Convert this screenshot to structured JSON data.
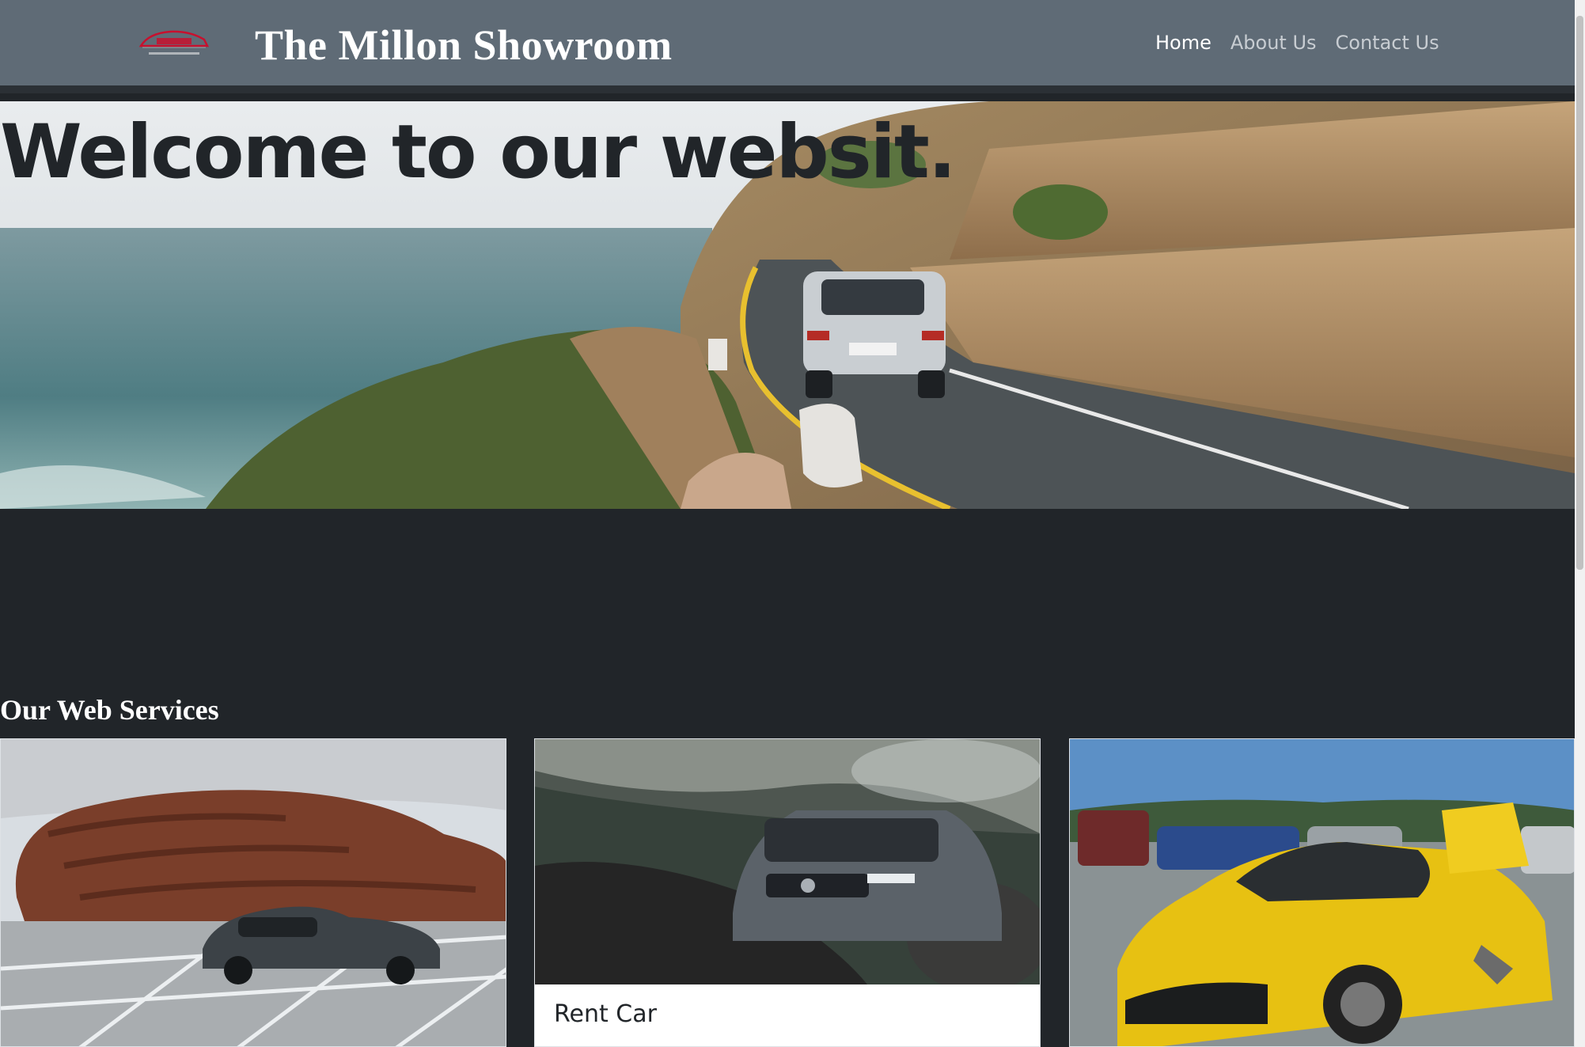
{
  "navbar": {
    "brand": "The Millon Showroom",
    "logo_icon": "red-car-logo-icon",
    "links": [
      {
        "label": "Home",
        "active": true
      },
      {
        "label": "About Us",
        "active": false
      },
      {
        "label": "Contact Us",
        "active": false
      }
    ]
  },
  "hero": {
    "title": "Welcome to our websit.",
    "image": "coastal-road-suv-photo"
  },
  "services": {
    "heading": "Our Web Services",
    "cards": [
      {
        "title": "",
        "image": "grey-sports-car-photo"
      },
      {
        "title": "Rent Car",
        "image": "grey-volvo-suv-photo"
      },
      {
        "title": "",
        "image": "yellow-damaged-charger-photo"
      }
    ]
  },
  "colors": {
    "navbar_bg": "#5f6b76",
    "page_bg": "#212529",
    "text_dark": "#212529",
    "text_light": "#ffffff"
  }
}
